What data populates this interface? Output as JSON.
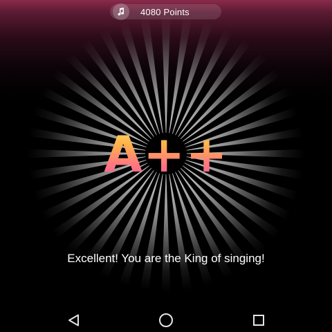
{
  "header": {
    "points_label": "4080 Points",
    "icon": "music-note-icon"
  },
  "result": {
    "grade": "A++",
    "message": "Excellent! You are the King of singing!"
  },
  "navigation": {
    "back_icon": "back-triangle-icon",
    "home_icon": "home-circle-icon",
    "recents_icon": "recents-square-icon"
  },
  "colors": {
    "grade_top": "#ffe268",
    "grade_bottom": "#ff4fa0",
    "header_tint": "#8a2a4a"
  }
}
